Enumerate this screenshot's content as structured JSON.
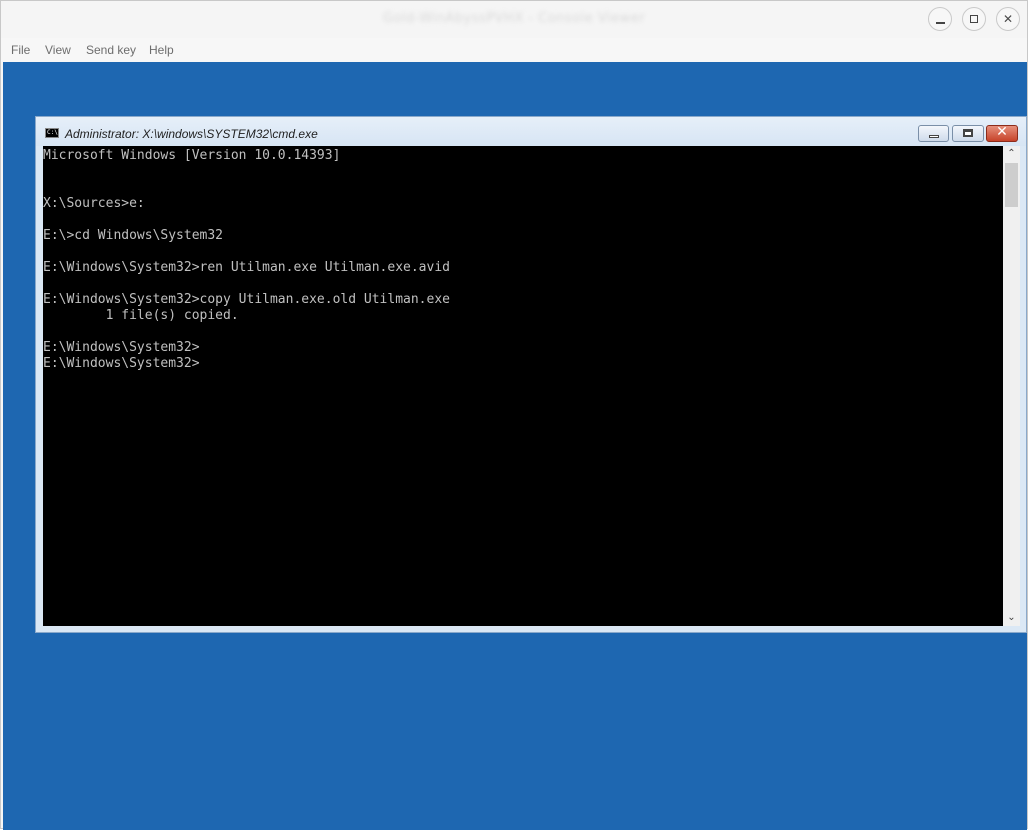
{
  "host": {
    "title": "Gold-WinAbyssPVHX - Console Viewer",
    "menu": [
      "File",
      "View",
      "Send key",
      "Help"
    ]
  },
  "cmd": {
    "title": "Administrator: X:\\windows\\SYSTEM32\\cmd.exe",
    "icon_text": "C:\\",
    "close_glyph": "✕",
    "scroll_up_glyph": "⌃",
    "scroll_down_glyph": "⌄",
    "console_text": "Microsoft Windows [Version 10.0.14393]\n\n\nX:\\Sources>e:\n\nE:\\>cd Windows\\System32\n\nE:\\Windows\\System32>ren Utilman.exe Utilman.exe.avid\n\nE:\\Windows\\System32>copy Utilman.exe.old Utilman.exe\n        1 file(s) copied.\n\nE:\\Windows\\System32>\nE:\\Windows\\System32>"
  }
}
